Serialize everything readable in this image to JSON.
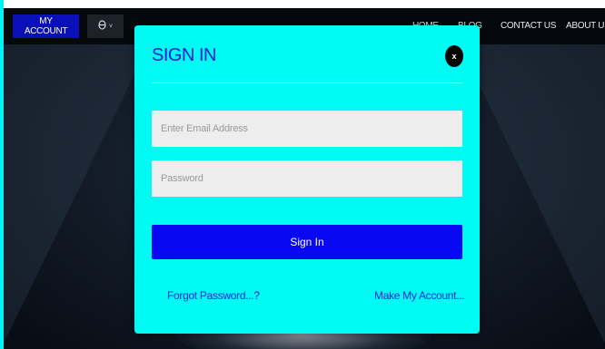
{
  "nav": {
    "account_label": "MY ACCOUNT",
    "user_icon": "user-icon",
    "caret": "˅",
    "links": [
      "HOME",
      "BLOG",
      "CONTACT US",
      "ABOUT US"
    ]
  },
  "modal": {
    "title": "SIGN IN",
    "close_label": "x",
    "email_placeholder": "Enter Email Address",
    "password_placeholder": "Password",
    "submit_label": "Sign In",
    "forgot_label": "Forgot Password...?",
    "create_label": "Make My Account..."
  },
  "colors": {
    "modal_bg": "#00fbf5",
    "primary": "#0808f2",
    "title": "#1520d8",
    "nav_bg": "#05080d",
    "account_button": "#0a10b8"
  }
}
